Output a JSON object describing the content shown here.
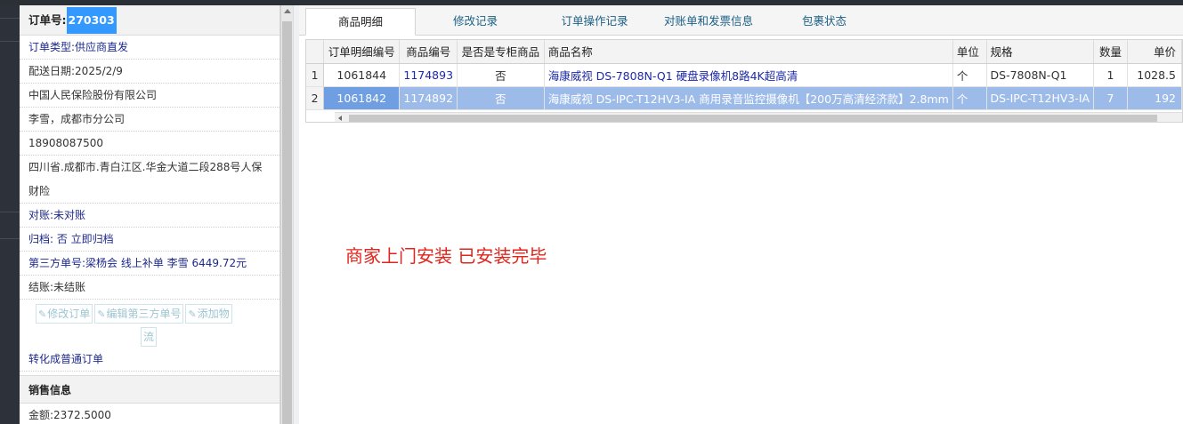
{
  "order": {
    "label": "订单号:",
    "number": "270303"
  },
  "info": {
    "type": "订单类型:供应商直发",
    "delivery_date": "配送日期:2025/2/9",
    "company": "中国人民保险股份有限公司",
    "contact": "李雪，成都市分公司",
    "phone": "18908087500",
    "address": "四川省.成都市.青白江区.华金大道二段288号人保财险",
    "reconcile": "对账:未对账",
    "archive": "归档:  否 立即归档",
    "third_party": "第三方单号:梁杨会 线上补单 李雪 6449.72元",
    "settle": "结账:未结账"
  },
  "actions": {
    "edit_order": "修改订单",
    "edit_third_party": "编辑第三方单号",
    "add_logistics_line1": "添加物",
    "add_logistics_line2": "流",
    "convert": "转化成普通订单"
  },
  "sales": {
    "title": "销售信息",
    "amount": "金额:2372.5000"
  },
  "tabs": [
    {
      "label": "商品明细",
      "active": true
    },
    {
      "label": "修改记录",
      "active": false
    },
    {
      "label": "订单操作记录",
      "active": false
    },
    {
      "label": "对账单和发票信息",
      "active": false
    },
    {
      "label": "包裹状态",
      "active": false
    }
  ],
  "grid": {
    "columns": [
      "订单明细编号",
      "商品编号",
      "是否是专柜商品",
      "商品名称",
      "单位",
      "规格",
      "数量",
      "单价"
    ],
    "rows": [
      {
        "rn": "1",
        "detail_no": "1061844",
        "product_no": "1174893",
        "counter": "否",
        "name": "海康威视 DS-7808N-Q1 硬盘录像机8路4K超高清",
        "unit": "个",
        "spec": "DS-7808N-Q1",
        "qty": "1",
        "price": "1028.5",
        "selected": false
      },
      {
        "rn": "2",
        "detail_no": "1061842",
        "product_no": "1174892",
        "counter": "否",
        "name": "海康威视 DS-IPC-T12HV3-IA 商用录音监控摄像机【200万高清经济款】2.8mm",
        "unit": "个",
        "spec": "DS-IPC-T12HV3-IA",
        "qty": "7",
        "price": "192",
        "selected": true
      }
    ]
  },
  "remark": "商家上门安装 已安装完毕",
  "colors": {
    "accent": "#3399ff",
    "selected_row": "#9cbbe9",
    "remark": "#e0251c",
    "link_blue": "#1e2a8c"
  }
}
